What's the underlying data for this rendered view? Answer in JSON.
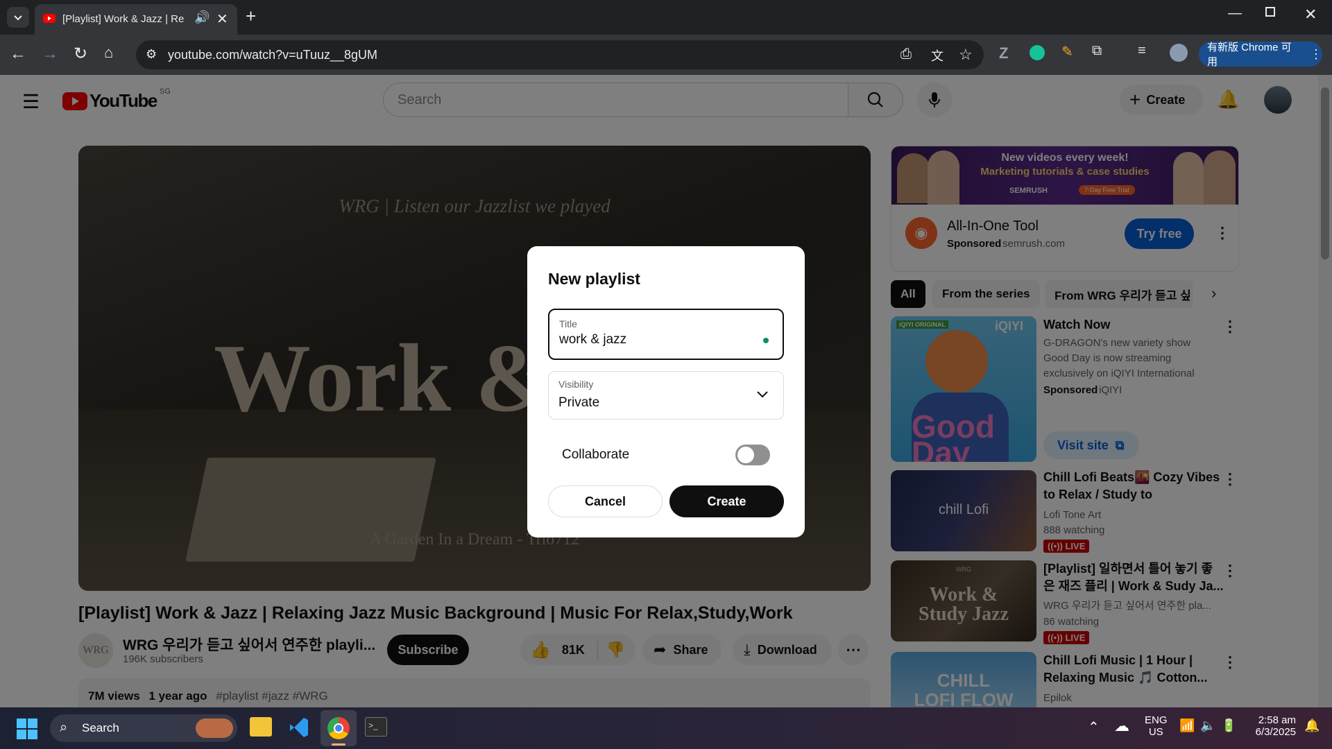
{
  "browser": {
    "tab_title": "[Playlist] Work & Jazz | Relaxing",
    "url": "youtube.com/watch?v=uTuuz__8gUM",
    "update_button": "有新版 Chrome 可用"
  },
  "youtube": {
    "logo_text": "YouTube",
    "region": "SG",
    "search_placeholder": "Search",
    "create_label": "Create"
  },
  "video": {
    "overlay_top": "WRG | Listen our Jazzlist we played",
    "overlay_big": "Work &",
    "overlay_bottom": "A Garden In a Dream - Trio712",
    "title": "[Playlist] Work & Jazz | Relaxing Jazz Music Background | Music For Relax,Study,Work",
    "channel_avatar": "WRG",
    "channel_name": "WRG 우리가 듣고 싶어서 연주한 playli...",
    "subscribers": "196K subscribers",
    "subscribe": "Subscribe",
    "likes": "81K",
    "share": "Share",
    "download": "Download",
    "views": "7M views",
    "age": "1 year ago",
    "hashtags": "#playlist #jazz #WRG"
  },
  "ad_banner": {
    "headline": "New videos every week!",
    "subline": "Marketing tutorials & case studies",
    "brand": "SEMRUSH",
    "trial": "7-Day Free Trial",
    "title": "All-In-One Tool",
    "sponsored": "Sponsored",
    "domain": "semrush.com",
    "cta": "Try free"
  },
  "chips": [
    "All",
    "From the series",
    "From WRG 우리가 듣고 싶"
  ],
  "related": [
    {
      "title": "Watch Now",
      "desc": "G-DRAGON's new variety show Good Day is now streaming exclusively on iQIYI International",
      "sponsored": "Sponsored",
      "source": "iQIYI",
      "cta": "Visit site",
      "thumb_tag": "iQIYI ORIGINAL",
      "thumb_brand": "iQIYI",
      "thumb_text": "Good Day"
    },
    {
      "title_1": "Chill Lofi Beats🌇 Cozy Vibes",
      "title_2": "to Relax / Study to",
      "channel": "Lofi Tone Art",
      "meta": "888 watching",
      "live": "LIVE",
      "thumb_text": "chill Lofi"
    },
    {
      "title_1": "[Playlist] 일하면서 틀어 놓기 좋",
      "title_2": "은 재즈 플리 | Work & Sudy Ja...",
      "channel": "WRG 우리가 듣고 싶어서 연주한 pla...",
      "meta": "86 watching",
      "live": "LIVE",
      "thumb_tag": "WRG",
      "thumb_text_1": "Work &",
      "thumb_text_2": "Study Jazz"
    },
    {
      "title_1": "Chill Lofi Music | 1 Hour |",
      "title_2": "Relaxing Music 🎵 Cotton...",
      "channel": "Epilok",
      "thumb_text_1": "CHILL",
      "thumb_text_2": "LOFI FLOW"
    }
  ],
  "dialog": {
    "heading": "New playlist",
    "title_label": "Title",
    "title_value": "work & jazz",
    "visibility_label": "Visibility",
    "visibility_value": "Private",
    "collaborate_label": "Collaborate",
    "collaborate_on": false,
    "cancel": "Cancel",
    "create": "Create"
  },
  "taskbar": {
    "search_label": "Search",
    "lang_1": "ENG",
    "lang_2": "US",
    "time": "2:58 am",
    "date": "6/3/2025"
  },
  "colors": {
    "yt_red": "#ff0000",
    "accent_blue": "#065fd4",
    "dialog_dot": "#0b8f6a"
  }
}
